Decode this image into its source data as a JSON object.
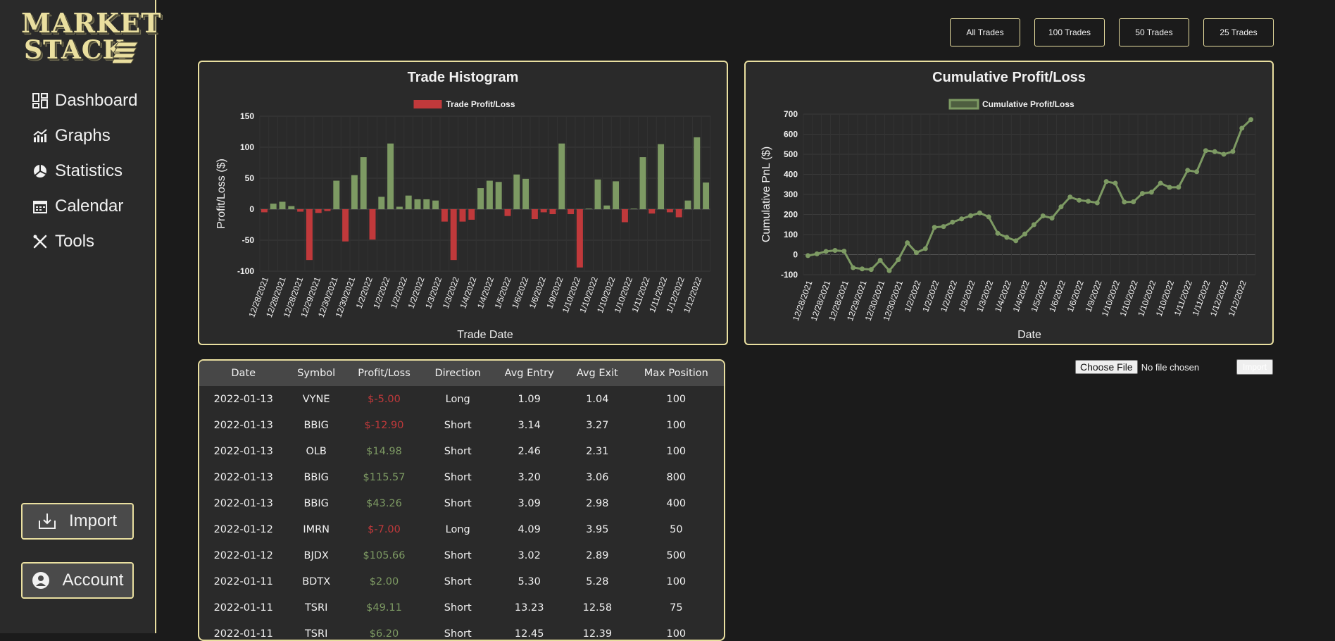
{
  "app": {
    "logo_line1": "MARKET",
    "logo_line2": "STACK",
    "accent": "#e9dfa0",
    "positive_color": "#7d9a63",
    "negative_color": "#c0393b"
  },
  "sidebar": {
    "items": [
      {
        "label": "Dashboard",
        "icon": "dashboard-icon"
      },
      {
        "label": "Graphs",
        "icon": "graph-icon"
      },
      {
        "label": "Statistics",
        "icon": "pie-chart-icon"
      },
      {
        "label": "Calendar",
        "icon": "calendar-icon"
      },
      {
        "label": "Tools",
        "icon": "tools-icon"
      }
    ],
    "import_label": "Import",
    "account_label": "Account"
  },
  "filters": [
    "All Trades",
    "100 Trades",
    "50 Trades",
    "25 Trades"
  ],
  "file_input": {
    "button_label": "Choose File",
    "status": "No file chosen",
    "submit_label": "Import"
  },
  "table": {
    "columns": [
      "Date",
      "Symbol",
      "Profit/Loss",
      "Direction",
      "Avg Entry",
      "Avg Exit",
      "Max Position"
    ],
    "rows": [
      [
        "2022-01-13",
        "VYNE",
        "$-5.00",
        "Long",
        "1.09",
        "1.04",
        "100"
      ],
      [
        "2022-01-13",
        "BBIG",
        "$-12.90",
        "Short",
        "3.14",
        "3.27",
        "100"
      ],
      [
        "2022-01-13",
        "OLB",
        "$14.98",
        "Short",
        "2.46",
        "2.31",
        "100"
      ],
      [
        "2022-01-13",
        "BBIG",
        "$115.57",
        "Short",
        "3.20",
        "3.06",
        "800"
      ],
      [
        "2022-01-13",
        "BBIG",
        "$43.26",
        "Short",
        "3.09",
        "2.98",
        "400"
      ],
      [
        "2022-01-12",
        "IMRN",
        "$-7.00",
        "Long",
        "4.09",
        "3.95",
        "50"
      ],
      [
        "2022-01-12",
        "BJDX",
        "$105.66",
        "Short",
        "3.02",
        "2.89",
        "500"
      ],
      [
        "2022-01-11",
        "BDTX",
        "$2.00",
        "Short",
        "5.30",
        "5.28",
        "100"
      ],
      [
        "2022-01-11",
        "TSRI",
        "$49.11",
        "Short",
        "13.23",
        "12.58",
        "75"
      ],
      [
        "2022-01-11",
        "TSRI",
        "$6.20",
        "Short",
        "12.45",
        "12.39",
        "100"
      ]
    ]
  },
  "chart_data": [
    {
      "type": "bar",
      "title": "Trade Histogram",
      "legend": "Trade Profit/Loss",
      "xlabel": "Trade Date",
      "ylabel": "Profit/Loss ($)",
      "ylim": [
        -100,
        150
      ],
      "yticks": [
        150,
        100,
        50,
        0,
        -50,
        -100
      ],
      "grid": true,
      "colors": {
        "positive": "#7d9a63",
        "negative": "#c0393b"
      },
      "x_tick_labels": [
        "12/28/2021",
        "12/28/2021",
        "12/28/2021",
        "12/29/2021",
        "12/30/2021",
        "12/30/2021",
        "1/2/2022",
        "1/2/2022",
        "1/2/2022",
        "1/2/2022",
        "1/3/2022",
        "1/3/2022",
        "1/4/2022",
        "1/4/2022",
        "1/5/2022",
        "1/6/2022",
        "1/6/2022",
        "1/9/2022",
        "1/10/2022",
        "1/10/2022",
        "1/10/2022",
        "1/10/2022",
        "1/11/2022",
        "1/11/2022",
        "1/12/2022",
        "1/12/2022"
      ],
      "values": [
        -5,
        9,
        12,
        5,
        -4,
        -82,
        -6,
        -3,
        46,
        -52,
        55,
        84,
        -49,
        20,
        106,
        4,
        22,
        16,
        16,
        14,
        -20,
        -82,
        -20,
        -17,
        34,
        46,
        44,
        -11,
        56,
        49,
        -16,
        -5,
        -8,
        106,
        -8,
        -94,
        1,
        48,
        6,
        45,
        -21,
        1,
        84,
        -7,
        105,
        -5,
        -13,
        14,
        116,
        43
      ]
    },
    {
      "type": "line",
      "title": "Cumulative Profit/Loss",
      "legend": "Cumulative Profit/Loss",
      "xlabel": "Date",
      "ylabel": "Cumulative PnL ($)",
      "ylim": [
        -100,
        700
      ],
      "yticks": [
        700,
        600,
        500,
        400,
        300,
        200,
        100,
        0,
        -100
      ],
      "grid": true,
      "color": "#7d9a63",
      "x_tick_labels": [
        "12/28/2021",
        "12/28/2021",
        "12/28/2021",
        "12/29/2021",
        "12/30/2021",
        "12/30/2021",
        "1/2/2022",
        "1/2/2022",
        "1/2/2022",
        "1/3/2022",
        "1/3/2022",
        "1/4/2022",
        "1/4/2022",
        "1/5/2022",
        "1/6/2022",
        "1/6/2022",
        "1/9/2022",
        "1/10/2022",
        "1/10/2022",
        "1/10/2022",
        "1/10/2022",
        "1/11/2022",
        "1/11/2022",
        "1/12/2022",
        "1/12/2022"
      ],
      "values": [
        -5,
        4,
        16,
        21,
        17,
        -65,
        -71,
        -74,
        -28,
        -80,
        -25,
        59,
        10,
        30,
        136,
        140,
        162,
        178,
        194,
        208,
        188,
        106,
        86,
        69,
        103,
        149,
        193,
        182,
        238,
        287,
        271,
        266,
        258,
        364,
        356,
        262,
        263,
        305,
        311,
        356,
        335,
        336,
        420,
        413,
        518,
        513,
        500,
        514,
        630,
        673
      ]
    }
  ]
}
